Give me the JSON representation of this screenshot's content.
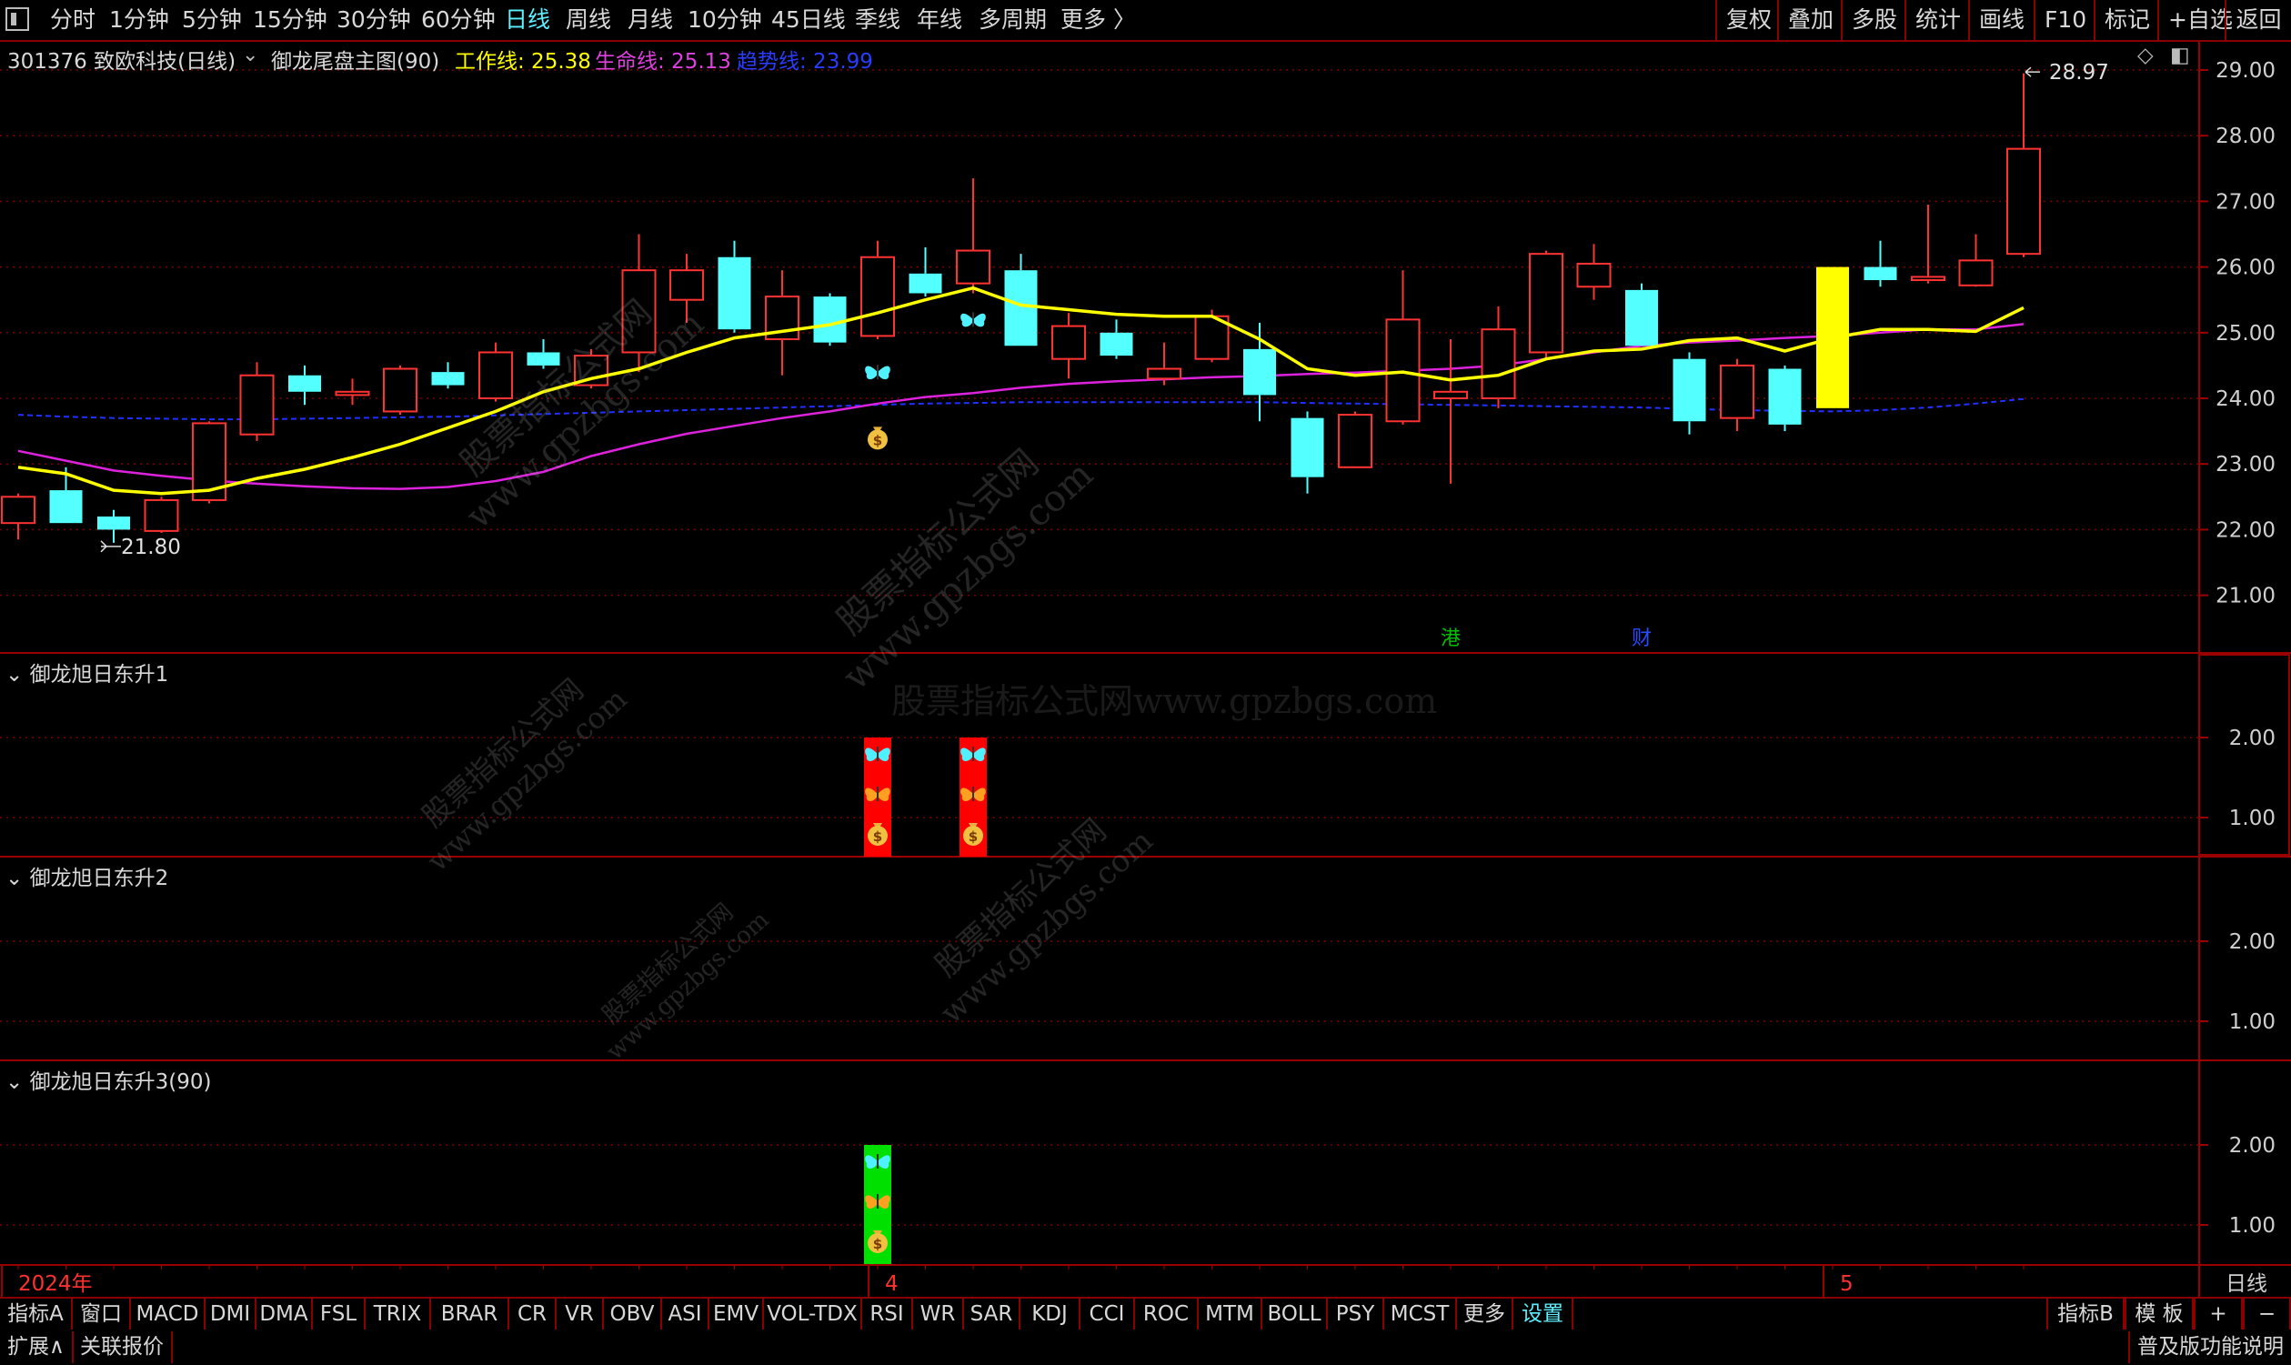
{
  "topbar": {
    "periods": [
      "分时",
      "1分钟",
      "5分钟",
      "15分钟",
      "30分钟",
      "60分钟",
      "日线",
      "周线",
      "月线",
      "10分钟",
      "45日线",
      "季线",
      "年线",
      "多周期",
      "更多 〉"
    ],
    "active_period": "日线",
    "right_buttons": [
      "复权",
      "叠加",
      "多股",
      "统计",
      "画线",
      "F10",
      "标记",
      "+自选",
      "返回"
    ]
  },
  "info": {
    "stock": "301376 致欧科技(日线)",
    "indicator": "御龙尾盘主图(90)",
    "work_label": "工作线: 25.38",
    "life_label": "生命线: 25.13",
    "trend_label": "趋势线: 23.99"
  },
  "colors": {
    "up": "#ff3232",
    "down": "#54ffff",
    "work": "#ffff00",
    "life": "#dd22dd",
    "trend": "#2030ff",
    "grid": "#7a0000",
    "highlight": "#ffff00",
    "panel_red": "#ff0000",
    "panel_green": "#00e000"
  },
  "panels": [
    {
      "title": "御龙旭日东升1",
      "ticks": [
        "2.00",
        "1.00"
      ]
    },
    {
      "title": "御龙旭日东升2",
      "ticks": [
        "2.00",
        "1.00"
      ]
    },
    {
      "title": "御龙旭日东升3(90)",
      "ticks": [
        "2.00",
        "1.00"
      ]
    }
  ],
  "axis": {
    "price_ticks": [
      "29.00",
      "28.00",
      "27.00",
      "26.00",
      "25.00",
      "24.00",
      "23.00",
      "22.00",
      "21.00"
    ],
    "x_labels": [
      {
        "label": "2024年",
        "index": 0
      },
      {
        "label": "4",
        "index": 18
      },
      {
        "label": "5",
        "index": 38
      }
    ],
    "period_label": "日线"
  },
  "chart_data": {
    "type": "candlestick",
    "ylim": [
      20.6,
      29.4
    ],
    "candles": [
      {
        "o": 22.1,
        "h": 22.55,
        "l": 21.85,
        "c": 22.5
      },
      {
        "o": 22.6,
        "h": 22.95,
        "l": 22.1,
        "c": 22.1
      },
      {
        "o": 22.2,
        "h": 22.3,
        "l": 21.8,
        "c": 22.0
      },
      {
        "o": 21.98,
        "h": 22.5,
        "l": 21.95,
        "c": 22.45
      },
      {
        "o": 22.45,
        "h": 23.65,
        "l": 22.4,
        "c": 23.62
      },
      {
        "o": 23.45,
        "h": 24.55,
        "l": 23.35,
        "c": 24.35
      },
      {
        "o": 24.35,
        "h": 24.5,
        "l": 23.9,
        "c": 24.1
      },
      {
        "o": 24.05,
        "h": 24.3,
        "l": 23.9,
        "c": 24.1
      },
      {
        "o": 23.8,
        "h": 24.5,
        "l": 23.75,
        "c": 24.45
      },
      {
        "o": 24.4,
        "h": 24.55,
        "l": 24.15,
        "c": 24.2
      },
      {
        "o": 24.0,
        "h": 24.85,
        "l": 23.95,
        "c": 24.7
      },
      {
        "o": 24.7,
        "h": 24.9,
        "l": 24.45,
        "c": 24.5
      },
      {
        "o": 24.2,
        "h": 24.75,
        "l": 24.15,
        "c": 24.65
      },
      {
        "o": 24.7,
        "h": 26.5,
        "l": 24.4,
        "c": 25.95
      },
      {
        "o": 25.5,
        "h": 26.2,
        "l": 25.15,
        "c": 25.95
      },
      {
        "o": 26.15,
        "h": 26.4,
        "l": 25.0,
        "c": 25.05
      },
      {
        "o": 24.9,
        "h": 25.95,
        "l": 24.35,
        "c": 25.55
      },
      {
        "o": 25.55,
        "h": 25.6,
        "l": 24.8,
        "c": 24.85
      },
      {
        "o": 24.95,
        "h": 26.4,
        "l": 24.9,
        "c": 26.15
      },
      {
        "o": 25.9,
        "h": 26.3,
        "l": 25.55,
        "c": 25.6
      },
      {
        "o": 25.75,
        "h": 27.35,
        "l": 25.6,
        "c": 26.25
      },
      {
        "o": 25.95,
        "h": 26.2,
        "l": 24.8,
        "c": 24.8
      },
      {
        "o": 24.6,
        "h": 25.3,
        "l": 24.3,
        "c": 25.1
      },
      {
        "o": 25.0,
        "h": 25.2,
        "l": 24.6,
        "c": 24.65
      },
      {
        "o": 24.3,
        "h": 24.85,
        "l": 24.2,
        "c": 24.45
      },
      {
        "o": 24.6,
        "h": 25.35,
        "l": 24.55,
        "c": 25.25
      },
      {
        "o": 24.75,
        "h": 25.15,
        "l": 23.65,
        "c": 24.05
      },
      {
        "o": 23.7,
        "h": 23.8,
        "l": 22.55,
        "c": 22.8
      },
      {
        "o": 22.95,
        "h": 23.8,
        "l": 22.95,
        "c": 23.75
      },
      {
        "o": 23.65,
        "h": 25.95,
        "l": 23.6,
        "c": 25.2
      },
      {
        "o": 24.0,
        "h": 24.9,
        "l": 22.7,
        "c": 24.1
      },
      {
        "o": 24.0,
        "h": 25.4,
        "l": 23.85,
        "c": 25.05
      },
      {
        "o": 24.7,
        "h": 26.25,
        "l": 24.6,
        "c": 26.2
      },
      {
        "o": 25.7,
        "h": 26.35,
        "l": 25.5,
        "c": 26.05
      },
      {
        "o": 25.65,
        "h": 25.75,
        "l": 24.85,
        "c": 24.8
      },
      {
        "o": 24.6,
        "h": 24.7,
        "l": 23.45,
        "c": 23.65
      },
      {
        "o": 23.7,
        "h": 24.6,
        "l": 23.5,
        "c": 24.5
      },
      {
        "o": 24.45,
        "h": 24.5,
        "l": 23.5,
        "c": 23.6
      },
      {
        "o": 23.85,
        "h": 26.0,
        "l": 23.85,
        "c": 26.0
      },
      {
        "o": 26.0,
        "h": 26.4,
        "l": 25.7,
        "c": 25.8
      },
      {
        "o": 25.8,
        "h": 26.95,
        "l": 25.75,
        "c": 25.85
      },
      {
        "o": 25.72,
        "h": 26.5,
        "l": 25.7,
        "c": 26.1
      },
      {
        "o": 26.2,
        "h": 28.95,
        "l": 26.15,
        "c": 27.8
      }
    ],
    "highlight_index": 38,
    "work_line": [
      22.95,
      22.85,
      22.6,
      22.55,
      22.6,
      22.78,
      22.92,
      23.1,
      23.3,
      23.55,
      23.8,
      24.1,
      24.3,
      24.45,
      24.7,
      24.92,
      25.02,
      25.12,
      25.3,
      25.5,
      25.68,
      25.42,
      25.35,
      25.28,
      25.25,
      25.25,
      24.9,
      24.45,
      24.35,
      24.4,
      24.28,
      24.35,
      24.6,
      24.72,
      24.75,
      24.88,
      24.92,
      24.72,
      24.92,
      25.05,
      25.05,
      25.02,
      25.38
    ],
    "life_line": [
      23.2,
      23.05,
      22.9,
      22.82,
      22.75,
      22.7,
      22.66,
      22.63,
      22.62,
      22.65,
      22.74,
      22.88,
      23.12,
      23.3,
      23.46,
      23.58,
      23.7,
      23.8,
      23.92,
      24.02,
      24.08,
      24.16,
      24.22,
      24.26,
      24.29,
      24.32,
      24.34,
      24.37,
      24.39,
      24.42,
      24.45,
      24.5,
      24.6,
      24.7,
      24.8,
      24.85,
      24.88,
      24.92,
      24.95,
      25.0,
      25.05,
      25.05,
      25.13
    ],
    "trend_line": [
      23.75,
      23.72,
      23.7,
      23.69,
      23.68,
      23.68,
      23.69,
      23.7,
      23.71,
      23.72,
      23.74,
      23.76,
      23.78,
      23.8,
      23.82,
      23.84,
      23.86,
      23.88,
      23.9,
      23.92,
      23.93,
      23.94,
      23.94,
      23.94,
      23.94,
      23.94,
      23.94,
      23.93,
      23.92,
      23.91,
      23.9,
      23.89,
      23.88,
      23.87,
      23.86,
      23.84,
      23.82,
      23.81,
      23.8,
      23.82,
      23.86,
      23.92,
      23.99
    ],
    "low_marker": {
      "index": 2,
      "value": 21.8,
      "label": "21.80"
    },
    "high_marker": {
      "index": 42,
      "value": 28.97,
      "label": "28.97"
    },
    "signals": [
      {
        "index": 18,
        "type": "butterfly",
        "value": 24.4
      },
      {
        "index": 18,
        "type": "money",
        "value": 23.4
      },
      {
        "index": 20,
        "type": "butterfly",
        "value": 25.2
      }
    ],
    "events": [
      {
        "index": 30,
        "label": "港",
        "color": "#00c000"
      },
      {
        "index": 34,
        "label": "财",
        "color": "#2a4cff"
      }
    ],
    "panel1_bars": [
      {
        "index": 18,
        "value": 2.0
      },
      {
        "index": 20,
        "value": 2.0
      }
    ],
    "panel3_bars": [
      {
        "index": 18,
        "value": 2.0
      }
    ]
  },
  "watermark": {
    "line1": "股票指标公式网",
    "line2": "www.gpzbgs.com",
    "flat": "股票指标公式网www.gpzbgs.com"
  },
  "tabs": [
    "指标A",
    "窗口",
    "MACD",
    "DMI",
    "DMA",
    "FSL",
    "TRIX",
    "BRAR",
    "CR",
    "VR",
    "OBV",
    "ASI",
    "EMV",
    "VOL-TDX",
    "RSI",
    "WR",
    "SAR",
    "KDJ",
    "CCI",
    "ROC",
    "MTM",
    "BOLL",
    "PSY",
    "MCST",
    "更多",
    "设置"
  ],
  "active_tab": "设置",
  "tabs_right": [
    "指标B",
    "模 板",
    "+",
    "−"
  ],
  "bottom": {
    "expand": "扩展∧",
    "linked": "关联报价",
    "right": "普及版功能说明"
  }
}
